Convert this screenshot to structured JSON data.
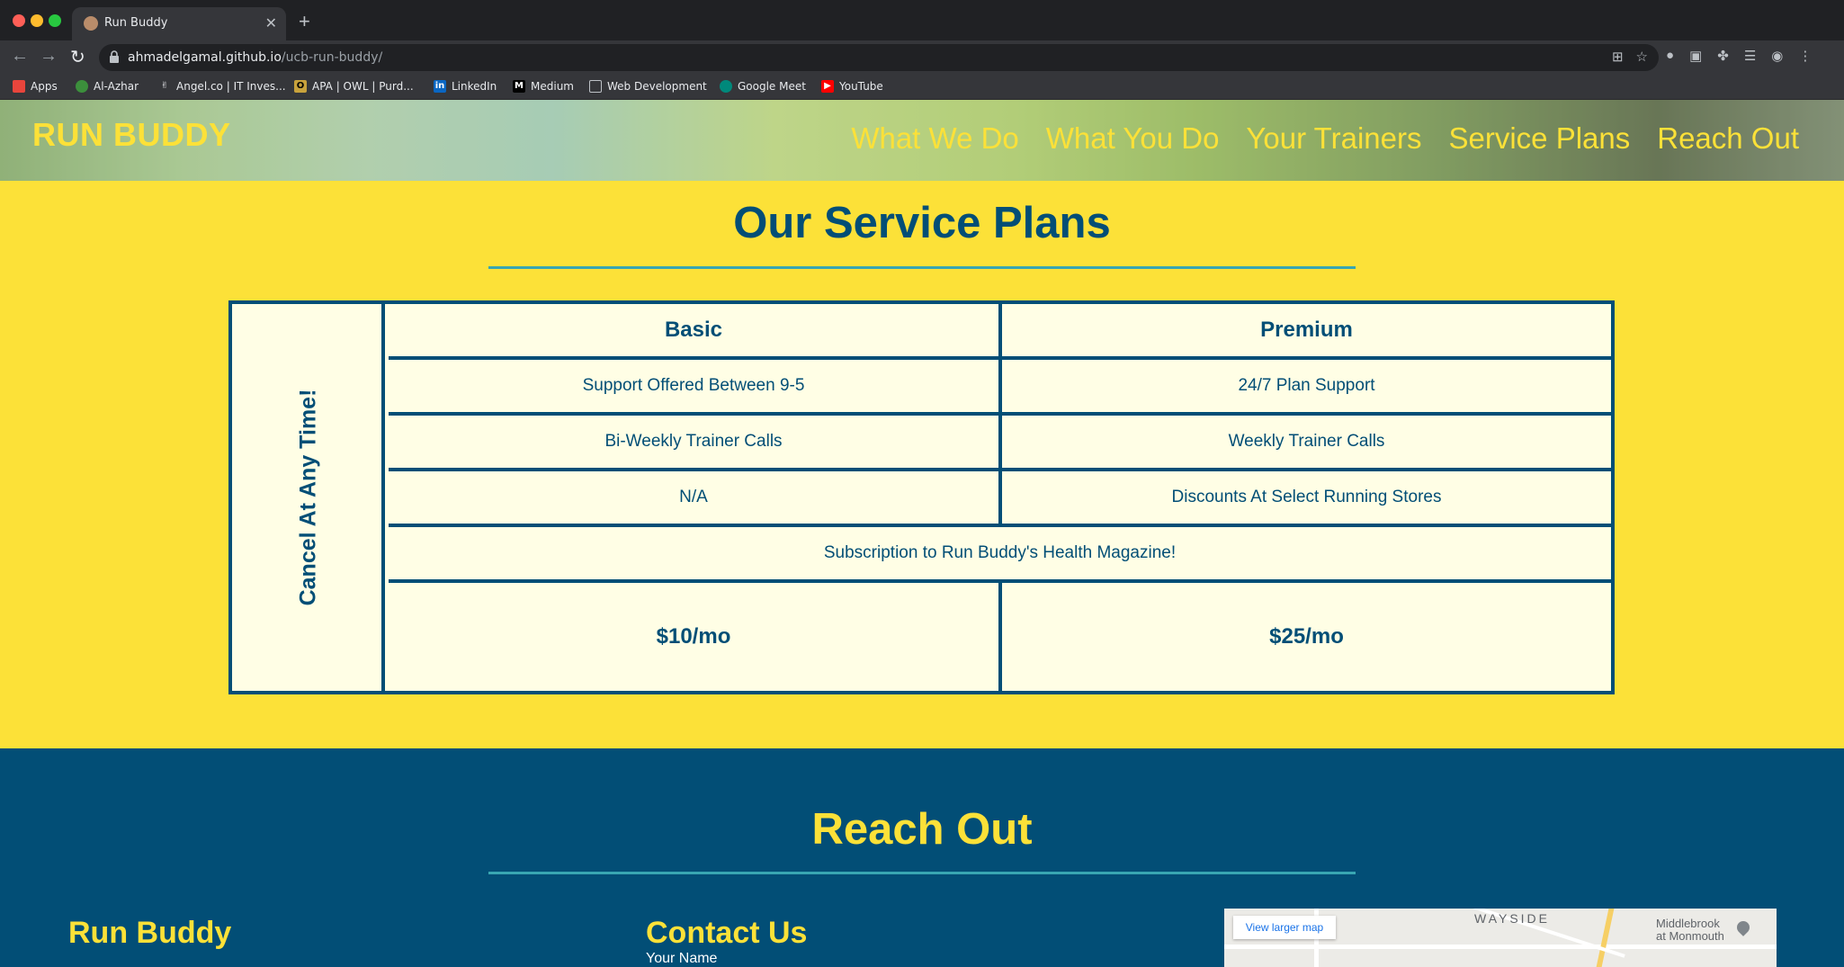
{
  "browser": {
    "tab_title": "Run Buddy",
    "url_host": "ahmadelgamal.github.io",
    "url_path": "/ucb-run-buddy/",
    "bookmarks": [
      "Apps",
      "Al-Azhar",
      "Angel.co | IT Inves...",
      "APA | OWL | Purd...",
      "LinkedIn",
      "Medium",
      "Web Development",
      "Google Meet",
      "YouTube"
    ]
  },
  "header": {
    "logo": "RUN BUDDY",
    "nav": [
      "What We Do",
      "What You Do",
      "Your Trainers",
      "Service Plans",
      "Reach Out"
    ]
  },
  "plans": {
    "title": "Our Service Plans",
    "side_label": "Cancel At Any Time!",
    "basic": {
      "name": "Basic",
      "support": "Support Offered Between 9-5",
      "calls": "Bi-Weekly Trainer Calls",
      "discounts": "N/A",
      "price": "$10/mo"
    },
    "premium": {
      "name": "Premium",
      "support": "24/7 Plan Support",
      "calls": "Weekly Trainer Calls",
      "discounts": "Discounts At Select Running Stores",
      "price": "$25/mo"
    },
    "shared": "Subscription to Run Buddy's Health Magazine!"
  },
  "reach": {
    "title": "Reach Out",
    "col1_title": "Run Buddy",
    "col2_title": "Contact Us",
    "name_label": "Your Name",
    "map": {
      "button": "View larger map",
      "area_label": "WAYSIDE",
      "place_line1": "Middlebrook",
      "place_line2": "at Monmouth"
    }
  },
  "colors": {
    "primary": "#024e76",
    "accent": "#fce138",
    "rule": "#39a6b2",
    "cell_bg": "#fffee5"
  }
}
